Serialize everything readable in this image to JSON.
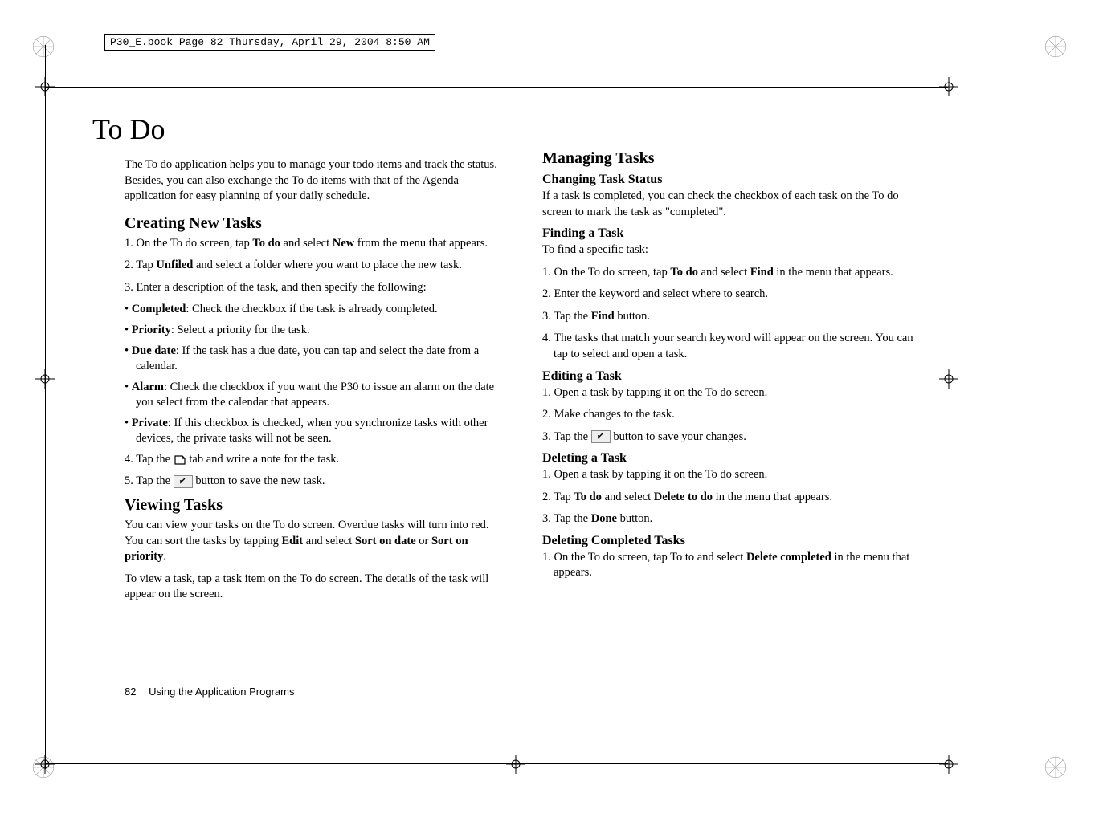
{
  "header": "P30_E.book  Page 82  Thursday, April 29, 2004  8:50 AM",
  "titleMain": "To Do",
  "intro": "The To do application helps you to manage your todo items and track the status. Besides, you can also exchange the To do items with that of the Agenda application for easy planning of your daily schedule.",
  "creating": {
    "heading": "Creating New Tasks",
    "s1a": "1. On the To do screen, tap ",
    "s1b": "To do",
    "s1c": " and select ",
    "s1d": "New",
    "s1e": " from the menu that appears.",
    "s2a": "2. Tap ",
    "s2b": "Unfiled",
    "s2c": " and select a folder where you want to place the new task.",
    "s3": "3. Enter a description of the task, and then specify the following:",
    "b1a": "• ",
    "b1b": "Completed",
    "b1c": ": Check the checkbox if the task is already completed.",
    "b2a": "• ",
    "b2b": "Priority",
    "b2c": ": Select a priority for the task.",
    "b3a": "• ",
    "b3b": "Due date",
    "b3c": ": If the task has a due date, you can tap and select the date from a calendar.",
    "b4a": "• ",
    "b4b": "Alarm",
    "b4c": ": Check the checkbox if you want the P30 to issue an alarm on the date you select from the calendar that appears.",
    "b5a": "• ",
    "b5b": "Private",
    "b5c": ": If this checkbox is checked, when you synchronize tasks with other devices, the private tasks will not be seen.",
    "s4a": "4. Tap the ",
    "s4b": " tab and write a note for the task.",
    "s5a": "5. Tap the ",
    "s5b": " button to save the new task."
  },
  "viewing": {
    "heading": "Viewing Tasks",
    "p1a": "You can view your tasks on the To do screen. Overdue tasks will turn into red. You can sort the tasks by tapping ",
    "p1b": "Edit",
    "p1c": " and select ",
    "p1d": "Sort on date",
    "p1e": " or ",
    "p1f": "Sort on priority",
    "p1g": ".",
    "p2": "To view a task, tap a task item on the To do screen. The details of the task will appear on the screen."
  },
  "managing": {
    "heading": "Managing Tasks",
    "changing": {
      "heading": "Changing Task Status",
      "p": "If a task is completed, you can check the checkbox of each task on the To do screen to mark the task as \"completed\"."
    },
    "finding": {
      "heading": "Finding a Task",
      "intro": "To find a specific task:",
      "s1a": "1. On the To do screen, tap ",
      "s1b": "To do",
      "s1c": " and select ",
      "s1d": "Find",
      "s1e": " in the menu that appears.",
      "s2": "2. Enter the keyword and select where to search.",
      "s3a": "3. Tap the ",
      "s3b": "Find",
      "s3c": " button.",
      "s4": "4. The tasks that match your search keyword will appear on the screen. You can tap to select and open a task."
    },
    "editing": {
      "heading": "Editing a Task",
      "s1": "1. Open a task by tapping it on the To do screen.",
      "s2": "2. Make changes to the task.",
      "s3a": "3. Tap the ",
      "s3b": " button to save your changes."
    },
    "deleting": {
      "heading": "Deleting a Task",
      "s1": "1. Open a task by tapping it on the To do screen.",
      "s2a": "2. Tap ",
      "s2b": "To do",
      "s2c": " and select ",
      "s2d": "Delete to do",
      "s2e": " in the menu that appears.",
      "s3a": "3. Tap the ",
      "s3b": "Done",
      "s3c": " button."
    },
    "deletingCompleted": {
      "heading": "Deleting Completed Tasks",
      "s1a": "1. On the To do screen, tap To to and select ",
      "s1b": "Delete completed",
      "s1c": " in the menu that appears."
    }
  },
  "footer": {
    "pageNum": "82",
    "section": "Using the Application Programs"
  }
}
